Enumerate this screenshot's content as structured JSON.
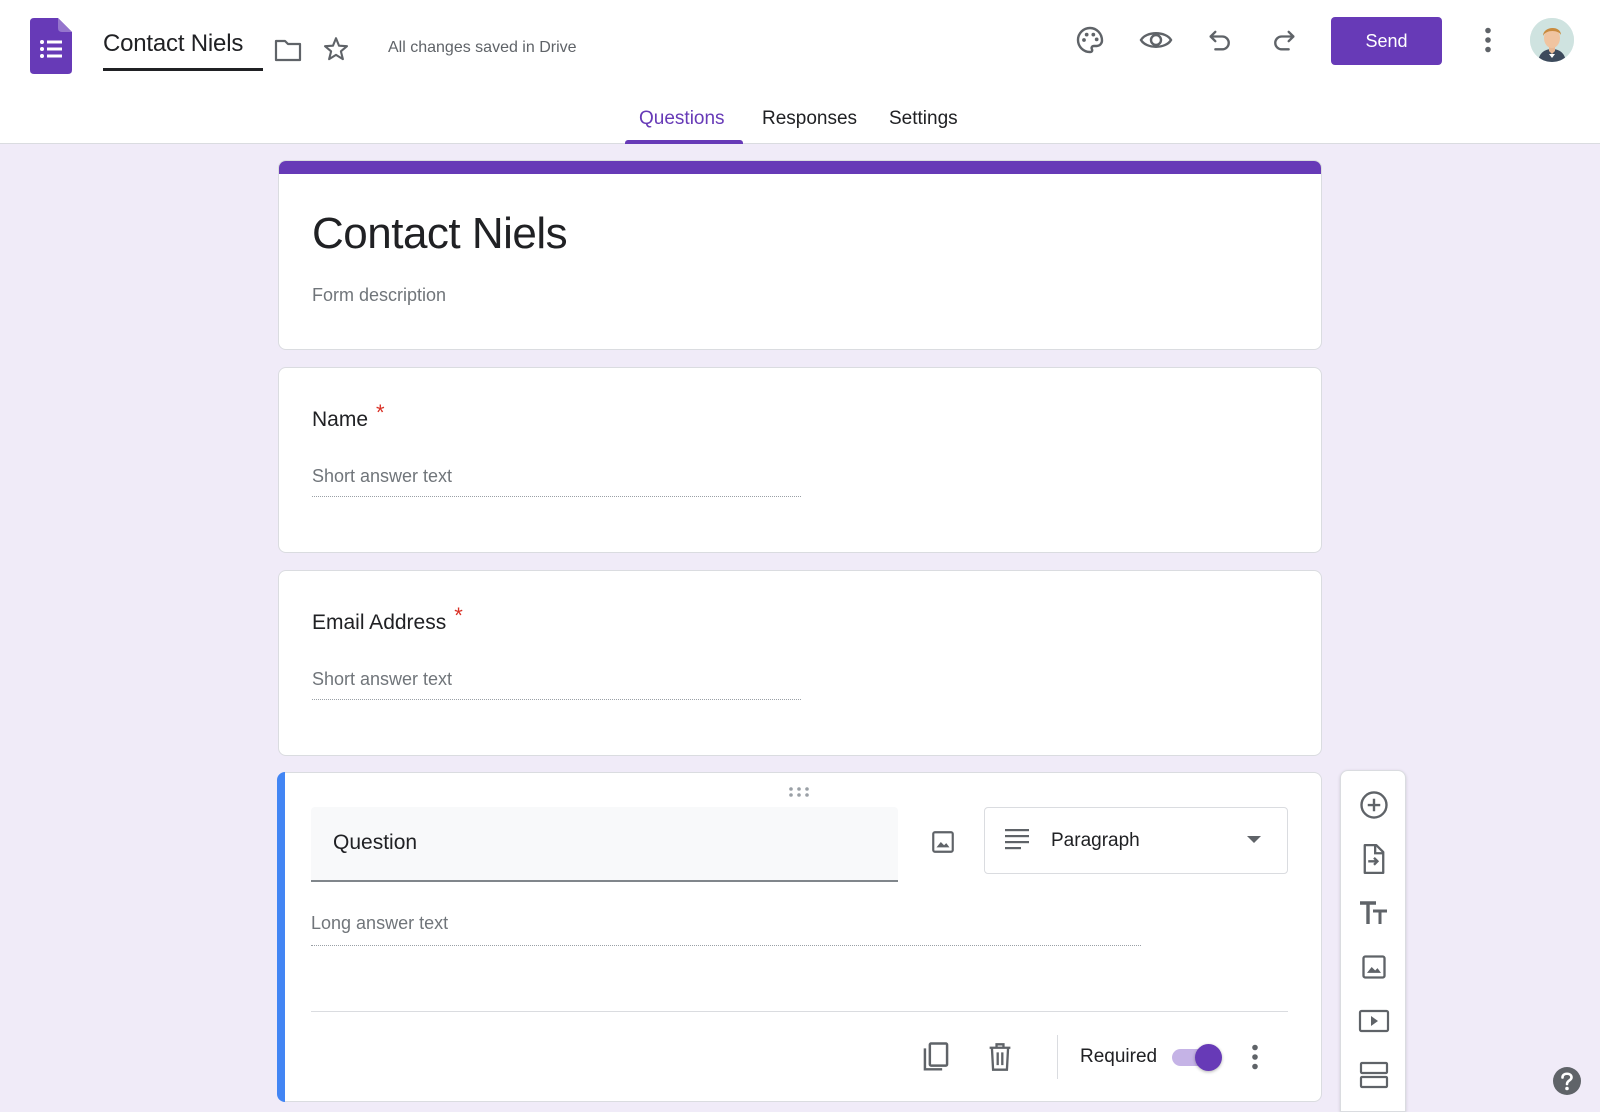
{
  "header": {
    "title": "Contact Niels",
    "save_status": "All changes saved in Drive",
    "send_label": "Send",
    "icons": [
      "forms-logo-icon",
      "folder-icon",
      "star-icon",
      "palette-icon",
      "eye-icon",
      "undo-icon",
      "redo-icon",
      "more-vert-icon"
    ],
    "tabs": [
      {
        "label": "Questions",
        "active": true
      },
      {
        "label": "Responses",
        "active": false
      },
      {
        "label": "Settings",
        "active": false
      }
    ]
  },
  "form": {
    "title": "Contact Niels",
    "description_placeholder": "Form description",
    "questions": [
      {
        "title": "Name",
        "required_mark": "*",
        "answer_placeholder": "Short answer text"
      },
      {
        "title": "Email Address",
        "required_mark": "*",
        "answer_placeholder": "Short answer text"
      }
    ],
    "active_question": {
      "title_placeholder": "Question",
      "type": "Paragraph",
      "answer_placeholder": "Long answer text",
      "required_label": "Required",
      "required": true
    }
  },
  "toolbar": {
    "icons": [
      "add-question-icon",
      "import-questions-icon",
      "add-title-icon",
      "add-image-icon",
      "add-video-icon",
      "add-section-icon"
    ]
  },
  "colors": {
    "accent": "#673ab7",
    "background": "#f0ebf8",
    "active_bar": "#4285f4",
    "required_star": "#d93025"
  }
}
